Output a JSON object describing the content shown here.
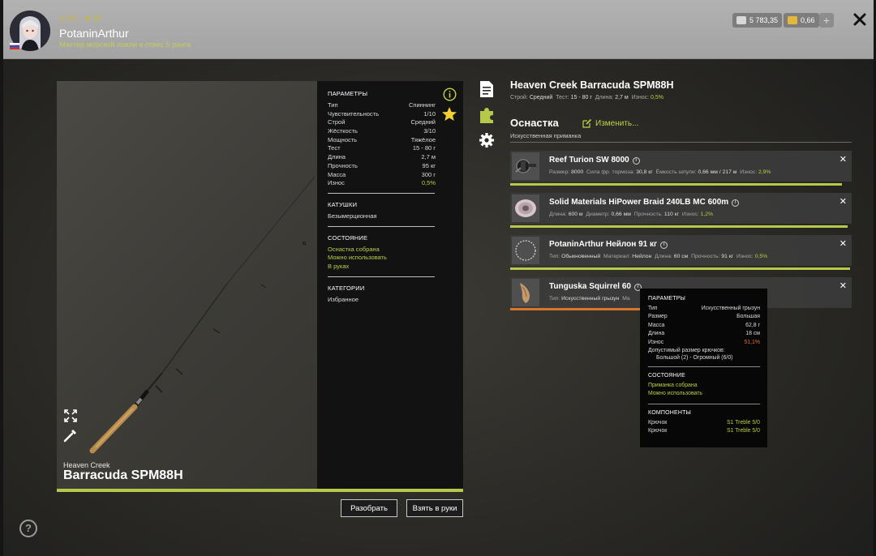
{
  "header": {
    "user_level": "42",
    "user_rating": "50",
    "username": "PotaninArthur",
    "rank": "Мастер морской ловли в отвес 5 ранга",
    "silver": "5 783,35",
    "gold": "0,66",
    "plus_label": "+",
    "icons": [
      "circle-level-icon",
      "star-rating-icon",
      "silver-icon",
      "gold-icon",
      "close-icon"
    ]
  },
  "rod": {
    "brand": "Heaven Creek",
    "name": "Barracuda SPM88H",
    "full_title": "Heaven Creek Barracuda SPM88H"
  },
  "params": {
    "title": "ПАРАМЕТРЫ",
    "rows": [
      {
        "k": "Тип",
        "v": "Спиннинг"
      },
      {
        "k": "Чувствительность",
        "v": "1/10"
      },
      {
        "k": "Строй",
        "v": "Средний"
      },
      {
        "k": "Жёсткость",
        "v": "3/10"
      },
      {
        "k": "Мощность",
        "v": "Тяжёлое"
      },
      {
        "k": "Тест",
        "v": "15 - 80 г"
      },
      {
        "k": "Длина",
        "v": "2,7 м"
      },
      {
        "k": "Прочность",
        "v": "95 кг"
      },
      {
        "k": "Масса",
        "v": "300 г"
      },
      {
        "k": "Износ",
        "v": "0,5%"
      }
    ],
    "reels_title": "КАТУШКИ",
    "reels_value": "Безымерционная",
    "state_title": "СОСТОЯНИЕ",
    "state_lines": [
      "Оснастка собрана",
      "Можно использовать",
      "В руках"
    ],
    "category_title": "КАТЕГОРИИ",
    "category_value": "Избранное"
  },
  "specs": {
    "build_label": "Строй:",
    "build": "Средний",
    "test_label": "Тест:",
    "test": "15 - 80 г",
    "length_label": "Длина:",
    "length": "2,7 м",
    "wear_label": "Износ:",
    "wear": "0,5%"
  },
  "tackle": {
    "title": "Оснастка",
    "edit_label": "Изменить...",
    "lure_label": "Искусственная приманка",
    "items": [
      {
        "name": "Reef Turion SW 8000",
        "specs": [
          {
            "k": "Размер:",
            "v": "8000"
          },
          {
            "k": "Сила фр. тормоза:",
            "v": "30,8 кг"
          },
          {
            "k": "Ёмкость шпули:",
            "v": "0,66 мм / 217 м"
          },
          {
            "k": "Износ:",
            "v": "2,9%",
            "green": true
          }
        ]
      },
      {
        "name": "Solid Materials HiPower Braid 240LB MC 600m",
        "specs": [
          {
            "k": "Длина:",
            "v": "600 м"
          },
          {
            "k": "Диаметр:",
            "v": "0,66 мм"
          },
          {
            "k": "Прочность:",
            "v": "110 кг"
          },
          {
            "k": "Износ:",
            "v": "1,2%",
            "green": true
          }
        ]
      },
      {
        "name": "PotaninArthur Нейлон 91 кг",
        "specs": [
          {
            "k": "Тип:",
            "v": "Обыкновенный"
          },
          {
            "k": "Материал:",
            "v": "Нейлон"
          },
          {
            "k": "Длина:",
            "v": "60 см"
          },
          {
            "k": "Прочность:",
            "v": "91 кг"
          },
          {
            "k": "Износ:",
            "v": "0,5%",
            "green": true
          }
        ]
      },
      {
        "name": "Tunguska Squirrel 60",
        "specs": [
          {
            "k": "Тип:",
            "v": "Искусственный грызун"
          },
          {
            "k": "Ма",
            "v": ""
          }
        ]
      }
    ],
    "durability": [
      0.971,
      0.988,
      0.995,
      0.489
    ],
    "colors": {
      "ok": "#b6c94a",
      "worn": "#d8762c"
    }
  },
  "tooltip": {
    "title": "ПАРАМЕТРЫ",
    "rows": [
      {
        "k": "Тип",
        "v": "Искусственный грызун"
      },
      {
        "k": "Размер",
        "v": "Большая"
      },
      {
        "k": "Масса",
        "v": "62,8 г"
      },
      {
        "k": "Длина",
        "v": "18 см"
      },
      {
        "k": "Износ",
        "v": "51,1%"
      }
    ],
    "hooks_label": "Допустимый размер крючков:",
    "hooks_value": "Большой (2) - Огромный (6/0)",
    "state_title": "СОСТОЯНИЕ",
    "state_lines": [
      "Приманка собрана",
      "Можно использовать"
    ],
    "components_title": "КОМПОНЕНТЫ",
    "components": [
      {
        "k": "Крючок",
        "v": "S1 Treble 5/0"
      },
      {
        "k": "Крючок",
        "v": "S1 Treble 5/0"
      }
    ]
  },
  "actions": {
    "disassemble": "Разобрать",
    "take_in_hands": "Взять в руки",
    "help": "?"
  },
  "colors": {
    "accent": "#b6c94a",
    "warning": "#d8762c",
    "panel": "#121212"
  }
}
